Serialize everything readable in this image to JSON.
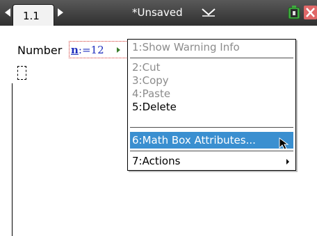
{
  "titlebar": {
    "page_tab_label": "1.1",
    "document_title": "*Unsaved"
  },
  "icons": {
    "prev_page": "chevron-left-icon",
    "next_page": "chevron-right-icon",
    "document_menu": "chevron-down-icon",
    "battery": "battery-icon",
    "close": "close-icon",
    "pointer": "mouse-cursor-icon"
  },
  "content": {
    "label": "Number",
    "math_variable": "n",
    "math_rest": ":=12"
  },
  "context_menu": {
    "items": [
      {
        "label": "1:Show Warning Info",
        "enabled": false
      },
      {
        "label": "2:Cut",
        "enabled": false
      },
      {
        "label": "3:Copy",
        "enabled": false
      },
      {
        "label": "4:Paste",
        "enabled": false
      },
      {
        "label": "5:Delete",
        "enabled": true
      },
      {
        "label": "6:Math Box Attributes...",
        "enabled": true,
        "highlighted": true
      },
      {
        "label": "7:Actions",
        "enabled": true,
        "has_submenu": true
      }
    ]
  },
  "colors": {
    "titlebar": "#3c3c3c",
    "highlight": "#3a8fd0",
    "math_text": "#1f2fbd",
    "math_box_border": "#d0302c",
    "disabled_text": "#8c8c8c"
  }
}
